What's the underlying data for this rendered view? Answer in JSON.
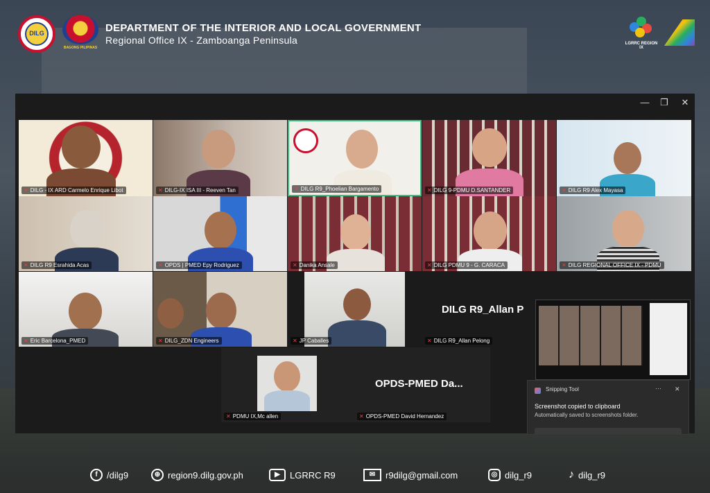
{
  "header": {
    "title": "DEPARTMENT OF THE INTERIOR AND LOCAL GOVERNMENT",
    "subtitle": "Regional Office IX - Zamboanga Peninsula",
    "logo_left_text": "DILG",
    "logo_left2_text": "BAGONG PILIPINAS",
    "logo_right_text": "LGRRC REGION IX"
  },
  "window_controls": {
    "minimize": "—",
    "restore": "❐",
    "close": "✕"
  },
  "participants": [
    {
      "name": "DILG - IX ARD Carmelo Enrique Libot"
    },
    {
      "name": "DILG-IX ISA III - Reeven Tan"
    },
    {
      "name": "DILG R9_Phoelian Bargamento"
    },
    {
      "name": "DILG 9-PDMU D.SANTANDER"
    },
    {
      "name": "DILG R9 Alex Mayasa"
    },
    {
      "name": "DILG R9 Esrahida Acas"
    },
    {
      "name": "OPDS | PMED Epy Rodriguez"
    },
    {
      "name": "Danika Ansale"
    },
    {
      "name": "DILG PDMU 9 - G. CARACA"
    },
    {
      "name": "DILG REGIONAL OFFICE IX - PDMU"
    },
    {
      "name": "Eric Barcelona_PMED"
    },
    {
      "name": "DILG_ZDN Engineers"
    },
    {
      "name": "JP Caballes"
    },
    {
      "name": "DILG R9_Allan Pelong",
      "big": "DILG R9_Allan P"
    },
    {
      "name": "PDMU IX,Mc allen"
    },
    {
      "name": "OPDS-PMED David Hernandez",
      "big": "OPDS-PMED  Da..."
    }
  ],
  "toast": {
    "app": "Snipping Tool",
    "title": "Screenshot copied to clipboard",
    "body": "Automatically saved to screenshots folder.",
    "more": "···",
    "close": "✕"
  },
  "footer": {
    "facebook": "/dilg9",
    "website": "region9.dilg.gov.ph",
    "youtube": "LGRRC R9",
    "email": "r9dilg@gmail.com",
    "instagram": "dilg_r9",
    "tiktok": "dilg_r9"
  },
  "colors": {
    "active_speaker": "#3fbf7f",
    "muted": "#e04848"
  }
}
